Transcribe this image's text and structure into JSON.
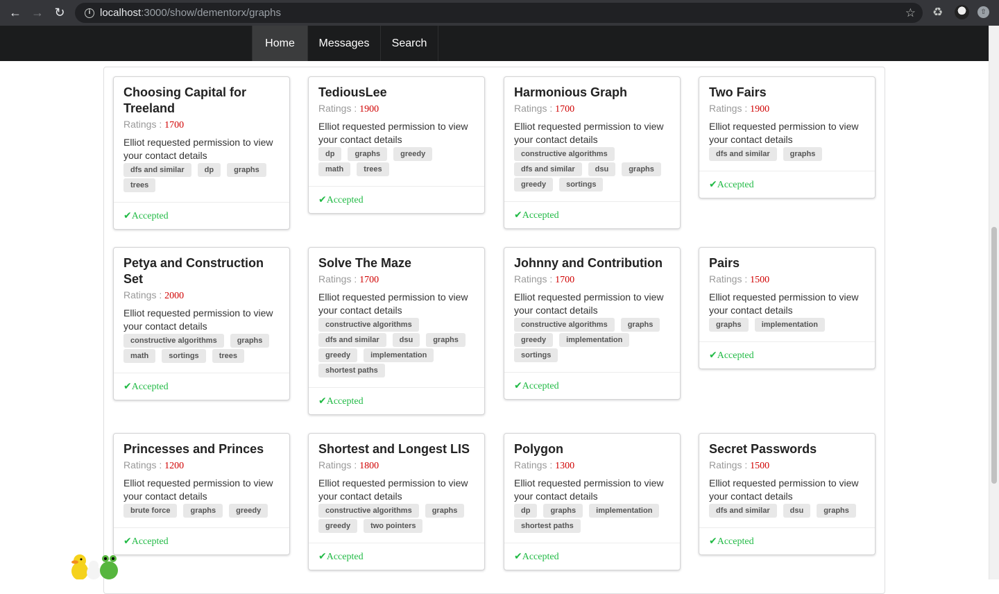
{
  "browser": {
    "url_host": "localhost",
    "url_path": ":3000/show/dementorx/graphs"
  },
  "navbar": {
    "items": [
      "Home",
      "Messages",
      "Search"
    ],
    "active": "Home"
  },
  "cards": [
    {
      "title": "Choosing Capital for Treeland",
      "rating_label": "Ratings :",
      "rating": "1700",
      "desc": "Elliot requested permission to view your contact details",
      "tags": [
        "dfs and similar",
        "dp",
        "graphs",
        "trees"
      ],
      "status": "Accepted"
    },
    {
      "title": "TediousLee",
      "rating_label": "Ratings :",
      "rating": "1900",
      "desc": "Elliot requested permission to view your contact details",
      "tags": [
        "dp",
        "graphs",
        "greedy",
        "math",
        "trees"
      ],
      "status": "Accepted"
    },
    {
      "title": "Harmonious Graph",
      "rating_label": "Ratings :",
      "rating": "1700",
      "desc": "Elliot requested permission to view your contact details",
      "tags": [
        "constructive algorithms",
        "dfs and similar",
        "dsu",
        "graphs",
        "greedy",
        "sortings"
      ],
      "status": "Accepted"
    },
    {
      "title": "Two Fairs",
      "rating_label": "Ratings :",
      "rating": "1900",
      "desc": "Elliot requested permission to view your contact details",
      "tags": [
        "dfs and similar",
        "graphs"
      ],
      "status": "Accepted"
    },
    {
      "title": "Petya and Construction Set",
      "rating_label": "Ratings :",
      "rating": "2000",
      "desc": "Elliot requested permission to view your contact details",
      "tags": [
        "constructive algorithms",
        "graphs",
        "math",
        "sortings",
        "trees"
      ],
      "status": "Accepted"
    },
    {
      "title": "Solve The Maze",
      "rating_label": "Ratings :",
      "rating": "1700",
      "desc": "Elliot requested permission to view your contact details",
      "tags": [
        "constructive algorithms",
        "dfs and similar",
        "dsu",
        "graphs",
        "greedy",
        "implementation",
        "shortest paths"
      ],
      "status": "Accepted"
    },
    {
      "title": "Johnny and Contribution",
      "rating_label": "Ratings :",
      "rating": "1700",
      "desc": "Elliot requested permission to view your contact details",
      "tags": [
        "constructive algorithms",
        "graphs",
        "greedy",
        "implementation",
        "sortings"
      ],
      "status": "Accepted"
    },
    {
      "title": "Pairs",
      "rating_label": "Ratings :",
      "rating": "1500",
      "desc": "Elliot requested permission to view your contact details",
      "tags": [
        "graphs",
        "implementation"
      ],
      "status": "Accepted"
    },
    {
      "title": "Princesses and Princes",
      "rating_label": "Ratings :",
      "rating": "1200",
      "desc": "Elliot requested permission to view your contact details",
      "tags": [
        "brute force",
        "graphs",
        "greedy"
      ],
      "status": "Accepted"
    },
    {
      "title": "Shortest and Longest LIS",
      "rating_label": "Ratings :",
      "rating": "1800",
      "desc": "Elliot requested permission to view your contact details",
      "tags": [
        "constructive algorithms",
        "graphs",
        "greedy",
        "two pointers"
      ],
      "status": "Accepted"
    },
    {
      "title": "Polygon",
      "rating_label": "Ratings :",
      "rating": "1300",
      "desc": "Elliot requested permission to view your contact details",
      "tags": [
        "dp",
        "graphs",
        "implementation",
        "shortest paths"
      ],
      "status": "Accepted"
    },
    {
      "title": "Secret Passwords",
      "rating_label": "Ratings :",
      "rating": "1500",
      "desc": "Elliot requested permission to view your contact details",
      "tags": [
        "dfs and similar",
        "dsu",
        "graphs"
      ],
      "status": "Accepted"
    }
  ],
  "colors": {
    "rating": "#d00000",
    "accepted": "#21ba45",
    "navbar": "#1b1c1d"
  }
}
